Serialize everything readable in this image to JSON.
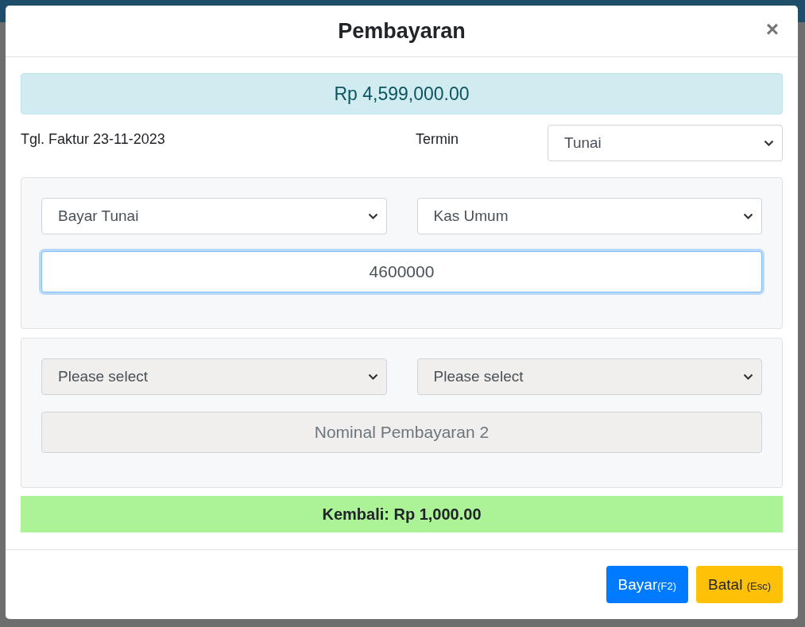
{
  "modal": {
    "title": "Pembayaran",
    "close": "×"
  },
  "total": "Rp 4,599,000.00",
  "invoice_date": "Tgl. Faktur 23-11-2023",
  "term": {
    "label": "Termin",
    "value": "Tunai"
  },
  "payments": [
    {
      "method": "Bayar Tunai",
      "account": "Kas Umum",
      "amount": {
        "value": "4600000"
      },
      "disabled": false,
      "focused": true
    },
    {
      "method": "Please select",
      "account": "Please select",
      "amount": {
        "placeholder": "Nominal Pembayaran 2"
      },
      "disabled": true,
      "focused": false
    }
  ],
  "change": "Kembali: Rp 1,000.00",
  "buttons": [
    {
      "label": "Bayar",
      "shortcut": "(F2)",
      "kind": "primary"
    },
    {
      "label": "Batal",
      "shortcut": "(Esc)",
      "kind": "warning"
    }
  ]
}
